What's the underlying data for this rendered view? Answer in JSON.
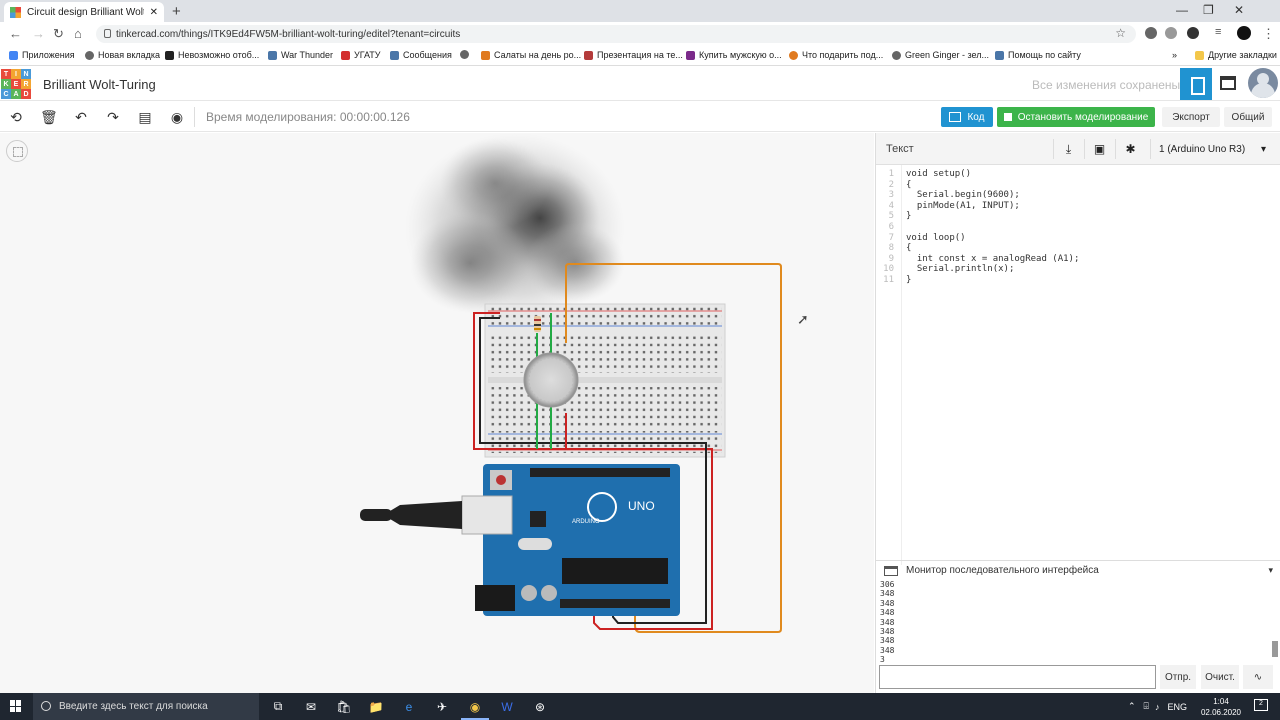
{
  "browser": {
    "tab_title": "Circuit design Brilliant Wolt-Turing",
    "new_tab_icon": "plus-icon",
    "url": "tinkercad.com/things/ITK9Ed4FW5M-brilliant-wolt-turing/editel?tenant=circuits",
    "bookmarks": [
      {
        "label": "Приложения",
        "color": "#4285f4"
      },
      {
        "label": "Новая вкладка",
        "color": "#666666"
      },
      {
        "label": "Невозможно отоб...",
        "color": "#222222"
      },
      {
        "label": "War Thunder",
        "color": "#4a76a8"
      },
      {
        "label": "УГАТУ",
        "color": "#d32f2f"
      },
      {
        "label": "Сообщения",
        "color": "#4a76a8"
      },
      {
        "label": "",
        "color": "#666666"
      },
      {
        "label": "Салаты на день ро...",
        "color": "#e07a1f"
      },
      {
        "label": "Презентация на те...",
        "color": "#b43b3b"
      },
      {
        "label": "Купить мужскую о...",
        "color": "#7b2a8a"
      },
      {
        "label": "Что подарить под...",
        "color": "#e07a1f"
      },
      {
        "label": "Green Ginger - зел...",
        "color": "#666666"
      },
      {
        "label": "Помощь по сайту",
        "color": "#4a76a8"
      }
    ],
    "more_bookmarks": "»",
    "other_bookmarks": "Другие закладки"
  },
  "header": {
    "logo_letters": [
      "TIN",
      "KER",
      "CAD"
    ],
    "logo_colors": [
      "#e84a3c",
      "#f3a531",
      "#4a9ad8",
      "#5ab55a",
      "#e84a3c",
      "#f3a531",
      "#4a9ad8",
      "#5ab55a",
      "#e84a3c"
    ],
    "design_title": "Brilliant Wolt-Turing",
    "saved_status": "Все изменения сохранены"
  },
  "toolbar": {
    "sim_time": "Время моделирования: 00:00:00.126",
    "code_label": "Код",
    "stop_label": "Остановить моделирование",
    "export_label": "Экспорт",
    "share_label": "Общий"
  },
  "panel": {
    "mode_label": "Текст",
    "board": "1 (Arduino Uno R3)",
    "code_lines": [
      "void setup()",
      "{",
      "  Serial.begin(9600);",
      "  pinMode(A1, INPUT);",
      "}",
      "",
      "void loop()",
      "{",
      "  int const x = analogRead (A1);",
      "  Serial.println(x);",
      "}"
    ],
    "serial_title": "Монитор последовательного интерфейса",
    "serial_output": [
      "306",
      "348",
      "348",
      "348",
      "348",
      "348",
      "348",
      "348",
      "3"
    ],
    "send_label": "Отпр.",
    "clear_label": "Очист."
  },
  "taskbar": {
    "search_placeholder": "Введите здесь текст для поиска",
    "lang": "ENG",
    "time": "1:04",
    "date": "02.06.2020",
    "notifications": "2"
  }
}
